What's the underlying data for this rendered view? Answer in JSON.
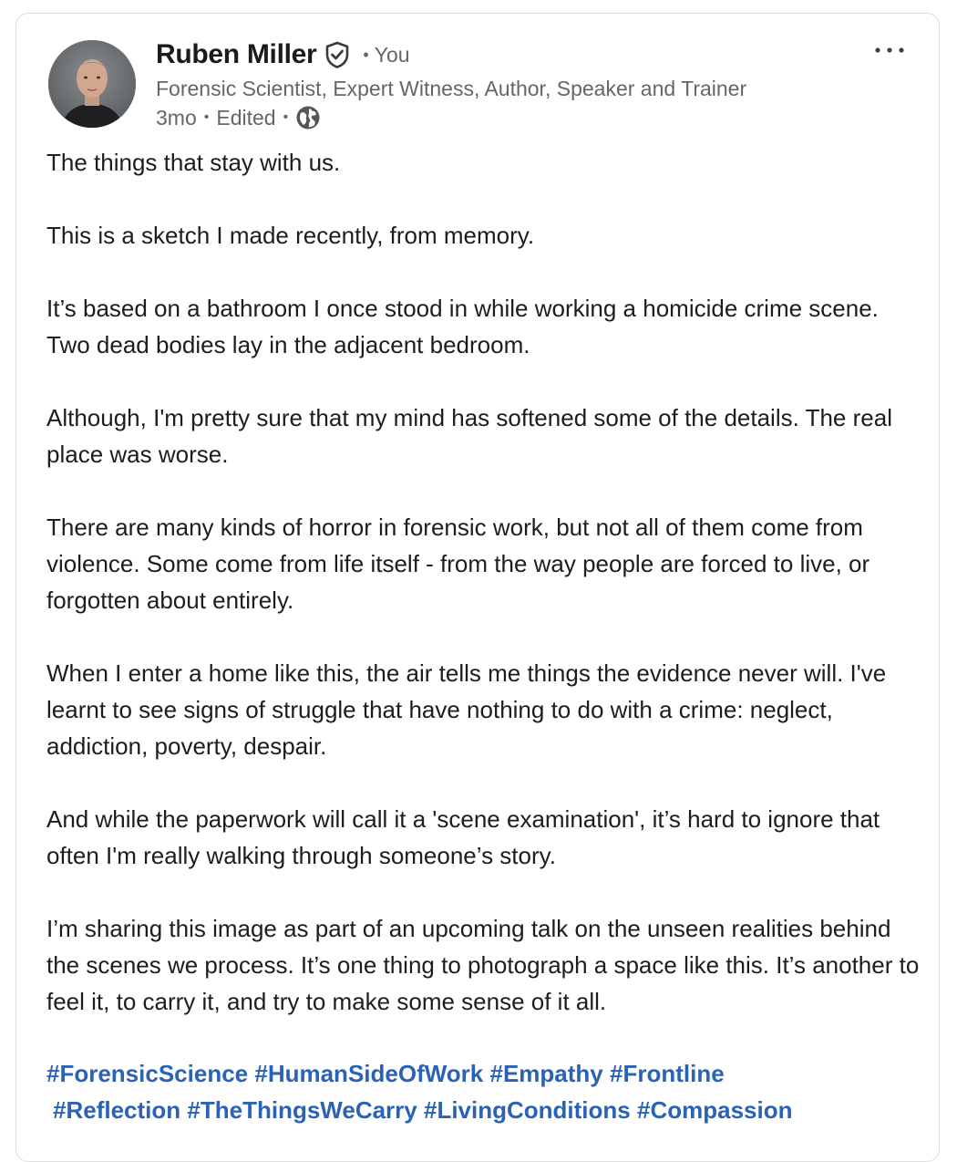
{
  "author": {
    "name": "Ruben Miller",
    "relation": "You",
    "headline": "Forensic Scientist, Expert Witness, Author, Speaker and Trainer",
    "time_ago": "3mo",
    "edited_label": "Edited",
    "visibility_icon": "globe-icon",
    "verified_icon": "verified-shield-icon",
    "avatar_icon": "avatar-photo"
  },
  "menu": {
    "more_icon": "ellipsis-icon"
  },
  "post": {
    "paragraphs": [
      "The things that stay with us.",
      "This is a sketch I made recently, from memory.",
      "It’s based on a bathroom I once stood in while working a homicide crime scene. Two dead bodies lay in the adjacent bedroom.",
      "Although, I'm pretty sure that my mind has softened some of the details. The real place was worse.",
      "There are many kinds of horror in forensic work, but not all of them come from violence. Some come from life itself - from the way people are forced to live, or forgotten about entirely.",
      "When I enter a home like this, the air tells me things the evidence never will. I've learnt to see signs of struggle that have nothing to do with a crime: neglect, addiction, poverty, despair.",
      "And while the paperwork will call it a 'scene examination', it’s hard to ignore that often I'm really walking through someone’s story.",
      "I’m sharing this image as part of an upcoming talk on the unseen realities behind the scenes we process. It’s one thing to photograph a space like this. It’s another to feel it, to carry it, and try to make some sense of it all."
    ],
    "hashtags": [
      "#ForensicScience",
      "#HumanSideOfWork",
      "#Empathy",
      "#Frontline",
      "#Reflection",
      "#TheThingsWeCarry",
      "#LivingConditions",
      "#Compassion"
    ]
  },
  "colors": {
    "hashtag": "#2a62b6",
    "secondary_text": "#666666",
    "primary_text": "#1d1d1d"
  }
}
